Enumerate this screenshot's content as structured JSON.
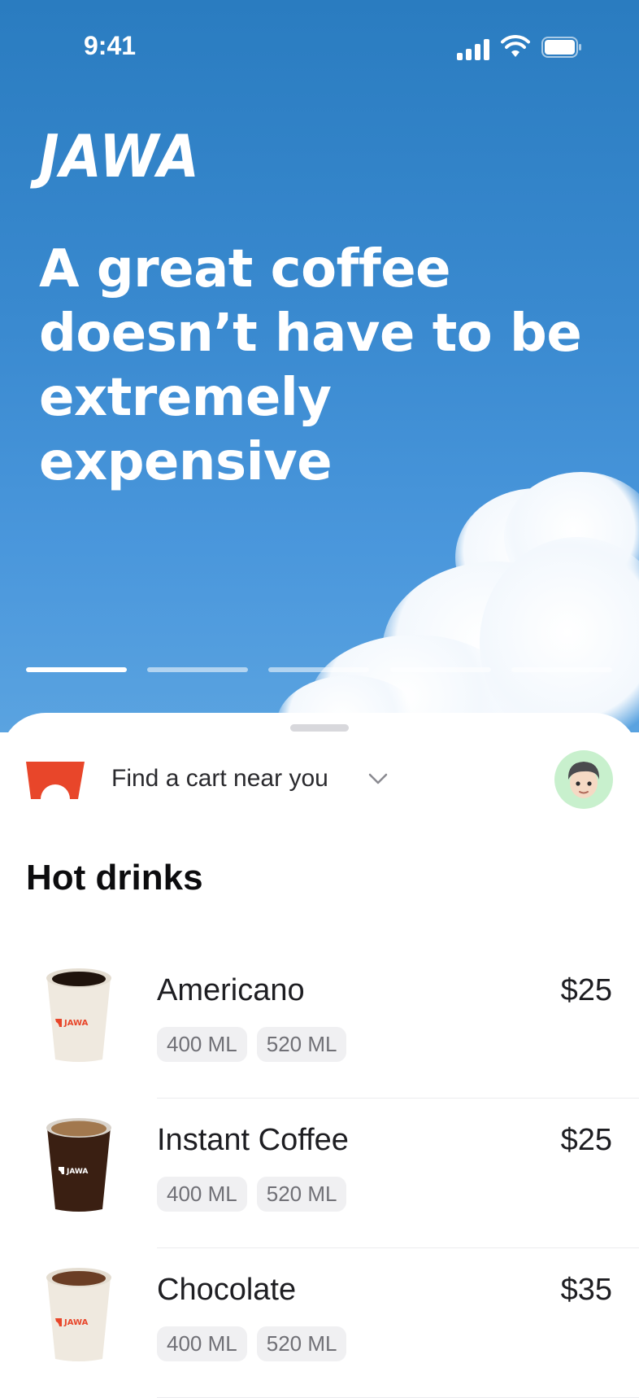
{
  "status_bar": {
    "time": "9:41"
  },
  "hero": {
    "logo": "JAWA",
    "headline": "A great coffee doesn’t have to be extremely expensive",
    "pager": {
      "count": 5,
      "active_index": 0
    }
  },
  "location": {
    "label": "Find a cart near you"
  },
  "section_title": "Hot drinks",
  "products": [
    {
      "name": "Americano",
      "price": "$25",
      "sizes": [
        "400 ML",
        "520 ML"
      ],
      "cup": "white"
    },
    {
      "name": "Instant Coffee",
      "price": "$25",
      "sizes": [
        "400 ML",
        "520 ML"
      ],
      "cup": "clear"
    },
    {
      "name": "Chocolate",
      "price": "$35",
      "sizes": [
        "400 ML",
        "520 ML"
      ],
      "cup": "white"
    }
  ],
  "colors": {
    "brand_orange": "#e8462a",
    "sky_blue": "#2f82c8",
    "avatar_bg": "#c8f0cd"
  }
}
